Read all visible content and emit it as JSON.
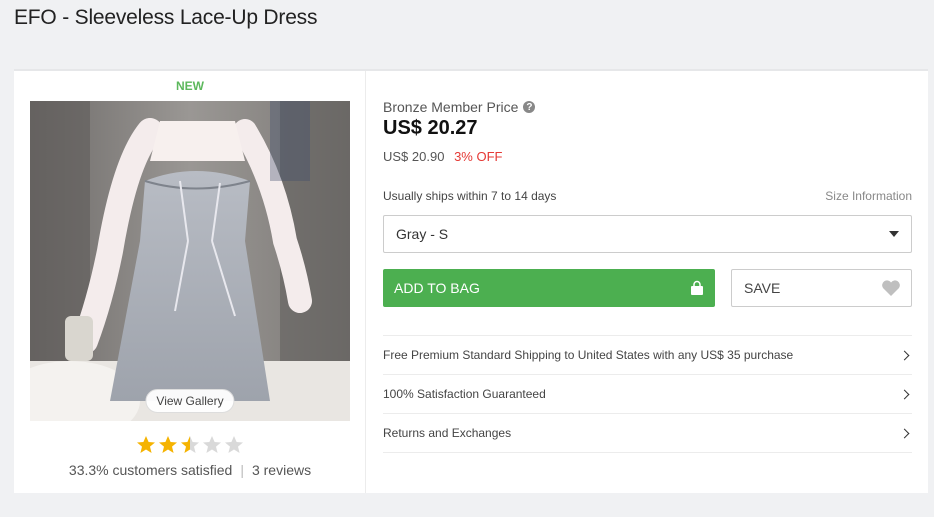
{
  "product": {
    "title": "EFO - Sleeveless Lace-Up Dress",
    "badge": "NEW",
    "gallery_label": "View Gallery",
    "rating": {
      "stars": 2.5,
      "max": 5,
      "satisfied": "33.3% customers satisfied",
      "reviews": "3 reviews"
    }
  },
  "pricing": {
    "member_label": "Bronze Member Price",
    "price": "US$ 20.27",
    "original_price": "US$ 20.90",
    "discount": "3% OFF"
  },
  "shipping": {
    "note": "Usually ships within 7 to 14 days",
    "size_info_link": "Size Information"
  },
  "variant": {
    "selected": "Gray - S"
  },
  "actions": {
    "add_to_bag": "ADD TO BAG",
    "save": "SAVE"
  },
  "info_rows": [
    "Free Premium Standard Shipping to United States with any US$ 35 purchase",
    "100% Satisfaction Guaranteed",
    "Returns and Exchanges"
  ],
  "colors": {
    "accent_green": "#4caf50",
    "new_green": "#5cb85c",
    "discount_red": "#e53935",
    "star_gold": "#f5b301",
    "star_gray": "#d9d9d9"
  },
  "icons": {
    "help": "question-circle-icon",
    "bag": "shopping-bag-icon",
    "heart": "heart-icon",
    "caret": "caret-down-icon",
    "chevron": "chevron-right-icon",
    "star": "star-icon"
  }
}
